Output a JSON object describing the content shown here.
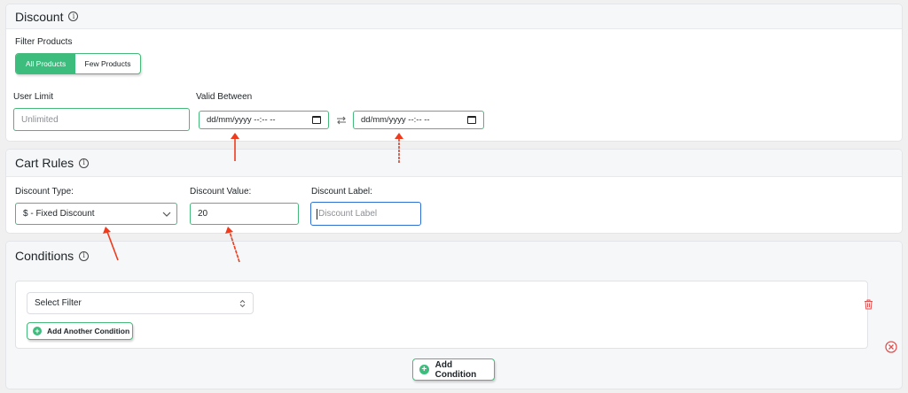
{
  "discount_panel": {
    "title": "Discount",
    "filter_label": "Filter Products",
    "filter_options": [
      "All Products",
      "Few Products"
    ],
    "user_limit_label": "User Limit",
    "user_limit_placeholder": "Unlimited",
    "valid_between_label": "Valid Between",
    "date_from_placeholder": "dd/mm/yyyy --:-- --",
    "date_to_placeholder": "dd/mm/yyyy --:-- --"
  },
  "cart_rules_panel": {
    "title": "Cart Rules",
    "discount_type_label": "Discount Type:",
    "discount_type_value": "$ - Fixed Discount",
    "discount_value_label": "Discount Value:",
    "discount_value": "20",
    "discount_label_label": "Discount Label:",
    "discount_label_placeholder": "Discount Label"
  },
  "conditions_panel": {
    "title": "Conditions",
    "select_filter_value": "Select Filter",
    "add_another_condition": "Add Another Condition",
    "add_condition": "Add Condition"
  },
  "icons": {
    "info": "info-icon",
    "calendar": "calendar-icon",
    "swap": "swap-arrows-icon",
    "chevron": "chevron-down-icon",
    "updown": "up-down-chevron-icon",
    "trash": "trash-icon",
    "close": "close-circle-icon",
    "plus": "plus-circle-icon",
    "annotation": "red-arrow-icon"
  },
  "colors": {
    "accent": "#3dbd7d",
    "field_border": "#46b97b",
    "focus_border": "#2f6fd1",
    "danger": "#e05252",
    "annotation": "#ee3b1e"
  }
}
